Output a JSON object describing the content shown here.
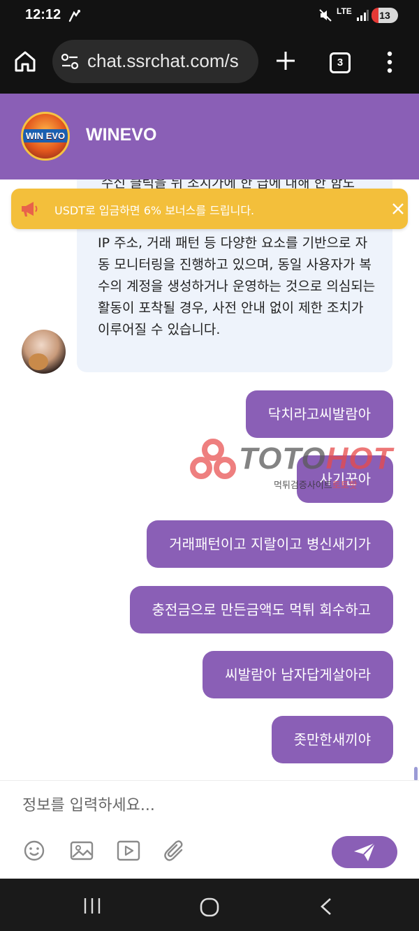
{
  "status_bar": {
    "time": "12:12",
    "network": "LTE",
    "battery": "13"
  },
  "browser": {
    "url": "chat.ssrchat.com/s",
    "tab_count": "3"
  },
  "chat": {
    "title": "WINEVO",
    "logo_text": "WIN EVO"
  },
  "notice": {
    "text": "USDT로 입금하면 6% 보너스를 드립니다."
  },
  "messages": {
    "agent_partial": "수신 클릭을 뒤 조치가에 한 급에 대해 한 함도",
    "agent_text": "IP 주소, 거래 패턴 등 다양한 요소를 기반으로 자동 모니터링을 진행하고 있으며, 동일 사용자가 복수의 계정을 생성하거나 운영하는 것으로 의심되는 활동이 포착될 경우, 사전 안내 없이 제한 조치가 이루어질 수 있습니다.",
    "user": [
      "닥치라고씨발람아",
      "사기꾼아",
      "거래패턴이고 지랄이고 병신새기가",
      "충전금으로 만든금액도 먹튀 회수하고",
      "씨발람아 남자답게살아라",
      "좃만한새끼야"
    ]
  },
  "watermark": {
    "brand_a": "TOTO",
    "brand_b": "HOT",
    "sub_a": "먹튀검증사이트",
    "sub_b": "토토핫"
  },
  "input": {
    "placeholder": "정보를 입력하세요..."
  },
  "colors": {
    "accent": "#8a5fb6",
    "notice": "#f3bf3b",
    "agent_bubble": "#eef3fb"
  }
}
